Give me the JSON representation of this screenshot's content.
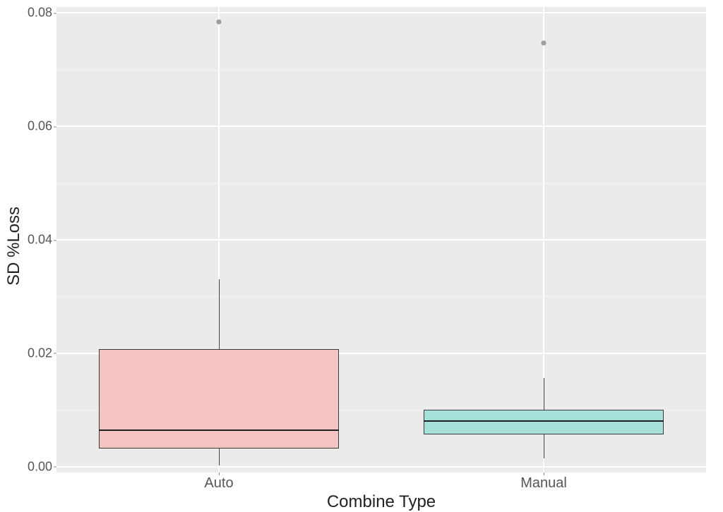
{
  "chart_data": {
    "type": "boxplot",
    "xlabel": "Combine Type",
    "ylabel": "SD %Loss",
    "ylim": [
      -0.001,
      0.081
    ],
    "y_ticks": [
      0.0,
      0.02,
      0.04,
      0.06,
      0.08
    ],
    "y_tick_labels": [
      "0.00",
      "0.02",
      "0.04",
      "0.06",
      "0.08"
    ],
    "categories": [
      "Auto",
      "Manual"
    ],
    "series": [
      {
        "name": "Auto",
        "color": "#f4c4c2",
        "stats": {
          "whisker_low": 0.0003,
          "q1": 0.0032,
          "median": 0.0064,
          "q3": 0.0208,
          "whisker_high": 0.033,
          "outliers": [
            0.0784
          ]
        }
      },
      {
        "name": "Manual",
        "color": "#a7e2da",
        "stats": {
          "whisker_low": 0.0015,
          "q1": 0.0057,
          "median": 0.0081,
          "q3": 0.0101,
          "whisker_high": 0.0157,
          "outliers": [
            0.0747
          ]
        }
      }
    ],
    "panel_bg": "#ebebeb",
    "grid_color": "#ffffff"
  }
}
